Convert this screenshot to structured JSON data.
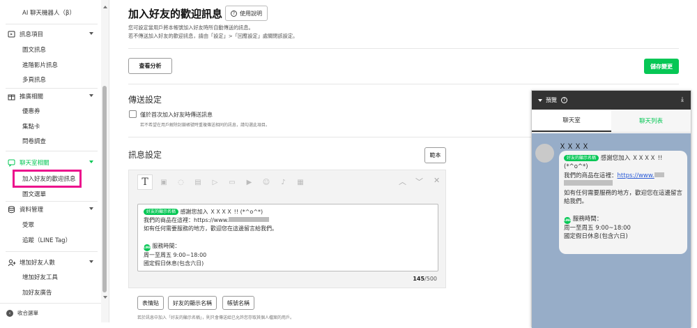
{
  "sidebar": {
    "top_item": "AI 聊天機器人（β）",
    "sections": [
      {
        "label": "訊息項目",
        "icon": "message-icon",
        "items": [
          "圖文訊息",
          "進階影片訊息",
          "多頁訊息"
        ]
      },
      {
        "label": "推廣相關",
        "icon": "gift-icon",
        "items": [
          "優惠券",
          "集點卡",
          "問卷調查"
        ]
      },
      {
        "label": "聊天室相關",
        "icon": "chat-icon",
        "items": [
          "加入好友的歡迎訊息",
          "圖文選單"
        ]
      },
      {
        "label": "資料管理",
        "icon": "database-icon",
        "items": [
          "受眾",
          "追蹤（LINE Tag）"
        ]
      },
      {
        "label": "增加好友人數",
        "icon": "add-friend-icon",
        "items": [
          "增加好友工具",
          "加好友廣告"
        ]
      }
    ],
    "footer": "收合選單"
  },
  "header": {
    "title": "加入好友的歡迎訊息",
    "help_label": "使用說明",
    "desc1": "您可設定當用戶將本帳號加入好友時所自動傳送的訊息。",
    "desc2": "若不傳送加入好友的歡迎訊息，請由「設定」>「回應設定」處關閉該設定。",
    "analysis_label": "查看分析",
    "save_label": "儲存變更"
  },
  "send_settings": {
    "title": "傳送設定",
    "checkbox_label": "僅於首次加入好友時傳送訊息",
    "checkbox_note": "若不希望在用戶解除封鎖帳號時重複傳送相同的訊息，請勾選此項目。",
    "checked": false
  },
  "message_settings": {
    "title": "訊息設定",
    "sample_label": "範本",
    "chip": "好友的顯示名稱",
    "line1_rest": "感謝您加入 ＸＸＸＸ !! (*^o^*)",
    "line2_prefix": "我們的商品在這裡：https://www.",
    "line3": "如有任何需要服務的地方，歡迎您在這邊留言給我們。",
    "line_icon_text": "LINE",
    "line5": "服務時間：",
    "line6": "周一至周五 9:00~18:00",
    "line7": "國定假日休息(包含六日)",
    "count_current": "145",
    "count_max": "/500",
    "insert_buttons": [
      "表情貼",
      "好友的顯示名稱",
      "帳號名稱"
    ],
    "bottom_note": "若於訊息中加入「好友的顯示名稱」，則只會傳送給已允許您存取其個人檔案的用戶。"
  },
  "preview": {
    "title": "預覽",
    "tabs": [
      "聊天室",
      "聊天列表"
    ],
    "account_name": "ＸＸＸＸ",
    "chip": "好友的顯示名稱",
    "l1_rest": "感謝您加入 ＸＸＸＸ !!",
    "l2": "(*^o^*)",
    "l3_prefix": "我們的商品在這裡：",
    "l3_link": "https://www.",
    "l4": "如有任何需要服務的地方，歡迎您在這邊留言給我們。",
    "l5": "服務時間：",
    "l6": "周一至周五 9:00~18:00",
    "l7": "國定假日休息(包含六日)"
  },
  "colors": {
    "brand_green": "#06c755",
    "highlight_pink": "#ec0e8c",
    "chat_bg": "#97adc8"
  }
}
